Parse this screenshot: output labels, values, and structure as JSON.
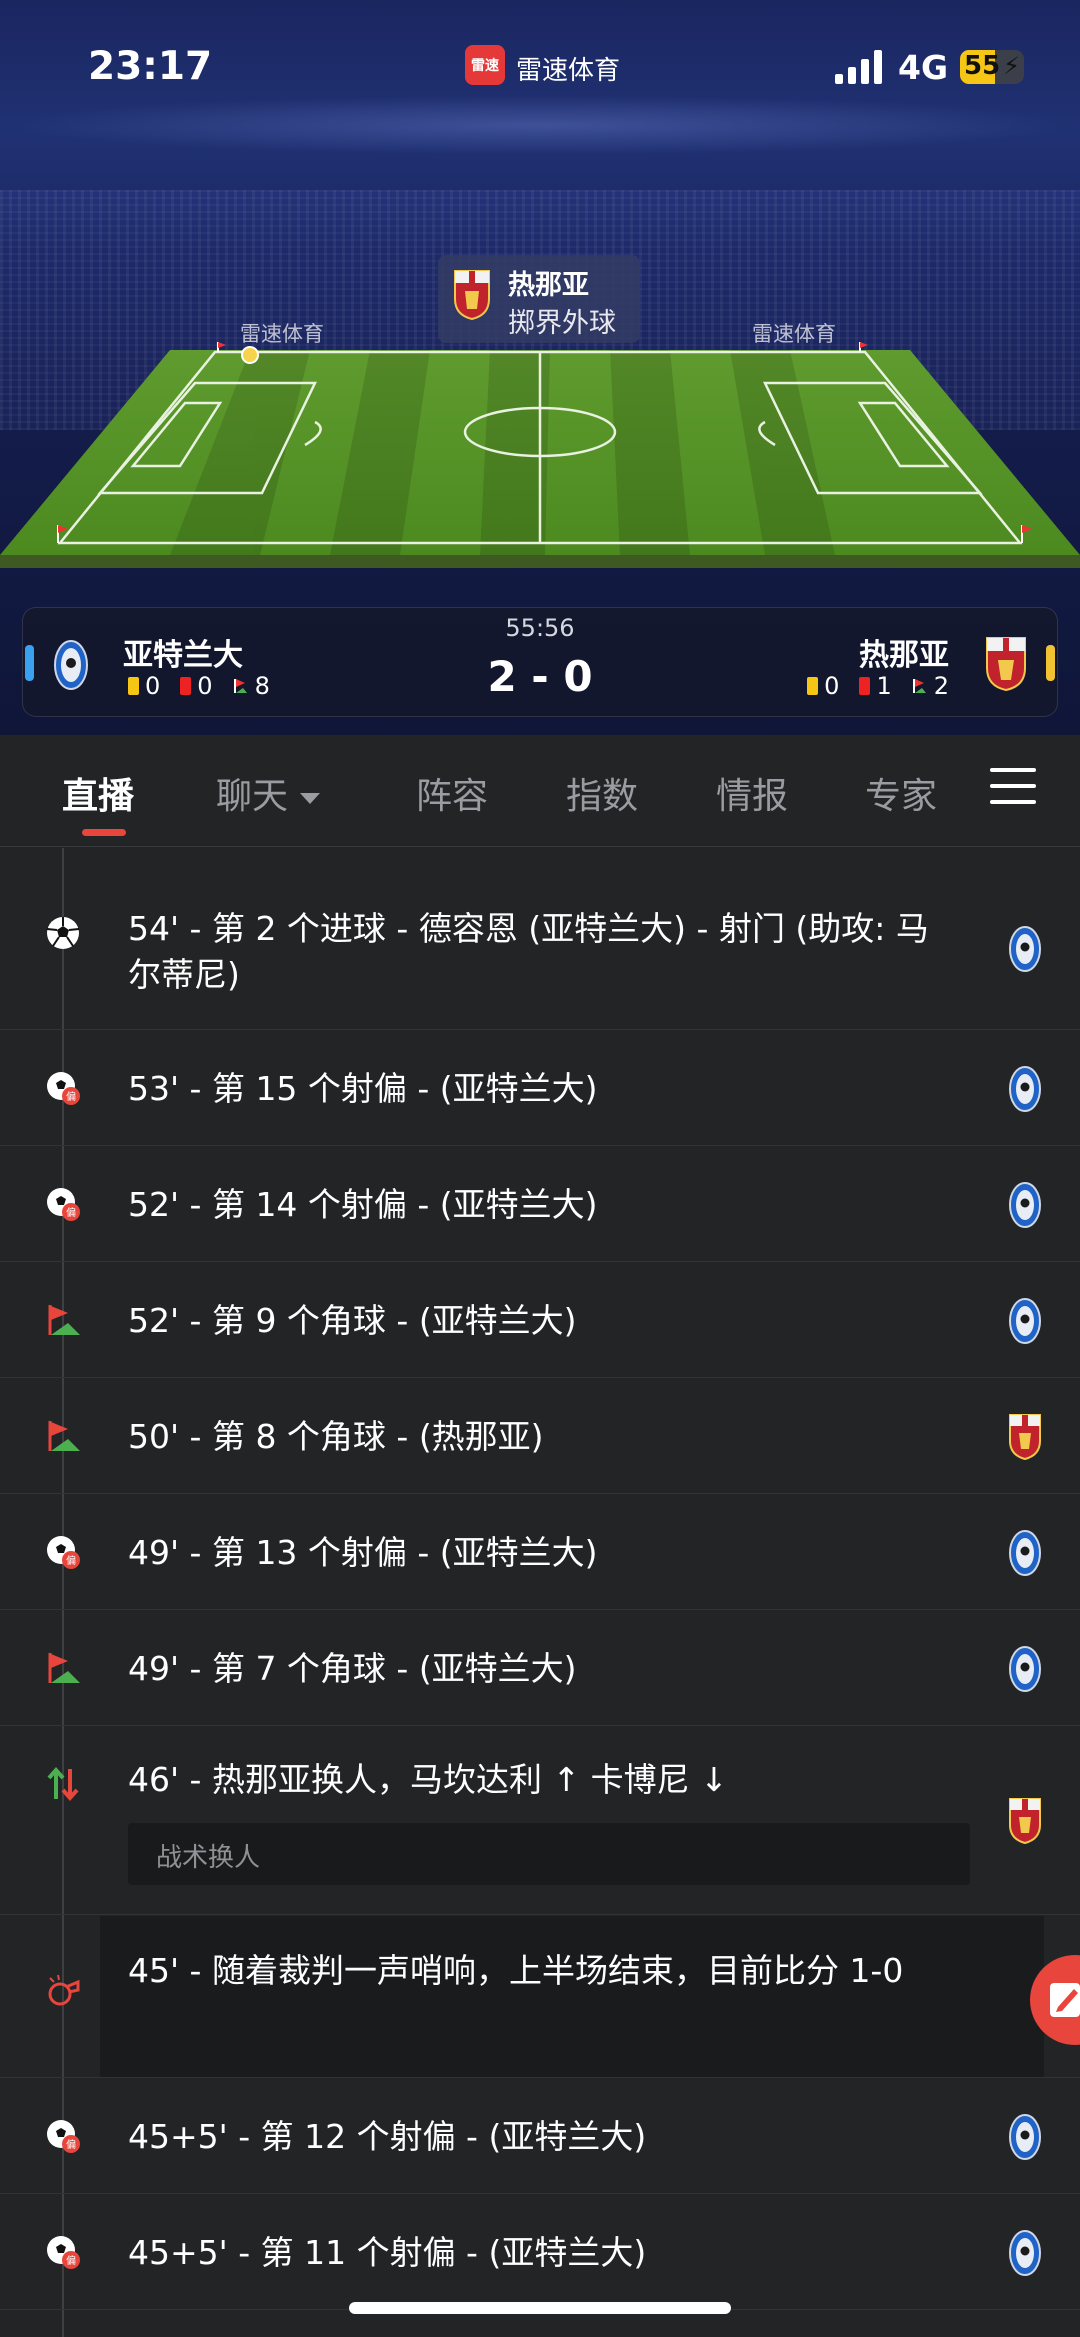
{
  "status_bar": {
    "time": "23:17",
    "app_name": "雷速体育",
    "app_badge": "雷速",
    "network": "4G",
    "battery": "55"
  },
  "pitch": {
    "event_team": "热那亚",
    "event_desc": "掷界外球",
    "ad_text": "雷速体育"
  },
  "match": {
    "clock": "55:56",
    "score": "2 - 0",
    "home": {
      "name": "亚特兰大",
      "yellow": "0",
      "red": "0",
      "corners": "8"
    },
    "away": {
      "name": "热那亚",
      "yellow": "0",
      "red": "1",
      "corners": "2"
    }
  },
  "tabs": [
    "直播",
    "聊天",
    "阵容",
    "指数",
    "情报",
    "专家"
  ],
  "events": [
    {
      "icon": "goal",
      "text": "54' - 第 2 个进球 - 德容恩 (亚特兰大) - 射门 (助攻: 马尔蒂尼)",
      "team": "home"
    },
    {
      "icon": "shot-off",
      "text": "53' - 第 15 个射偏 - (亚特兰大)",
      "team": "home"
    },
    {
      "icon": "shot-off",
      "text": "52' - 第 14 个射偏 - (亚特兰大)",
      "team": "home"
    },
    {
      "icon": "corner",
      "text": "52' - 第 9 个角球 - (亚特兰大)",
      "team": "home"
    },
    {
      "icon": "corner",
      "text": "50' - 第 8 个角球 - (热那亚)",
      "team": "away"
    },
    {
      "icon": "shot-off",
      "text": "49' - 第 13 个射偏 - (亚特兰大)",
      "team": "home"
    },
    {
      "icon": "corner",
      "text": "49' - 第 7 个角球 - (亚特兰大)",
      "team": "home"
    },
    {
      "icon": "substitution",
      "text": "46' - 热那亚换人，马坎达利 ↑ 卡博尼 ↓",
      "note": "战术换人",
      "team": "away"
    },
    {
      "icon": "whistle",
      "text": "45' - 随着裁判一声哨响，上半场结束，目前比分 1-0",
      "team": ""
    },
    {
      "icon": "shot-off",
      "text": "45+5' - 第 12 个射偏 - (亚特兰大)",
      "team": "home"
    },
    {
      "icon": "shot-off",
      "text": "45+5' - 第 11 个射偏 - (亚特兰大)",
      "team": "home"
    }
  ],
  "colors": {
    "accent": "#e8453c",
    "background": "#232426",
    "home_accent": "#3aa0f0",
    "away_accent": "#f1c232"
  }
}
